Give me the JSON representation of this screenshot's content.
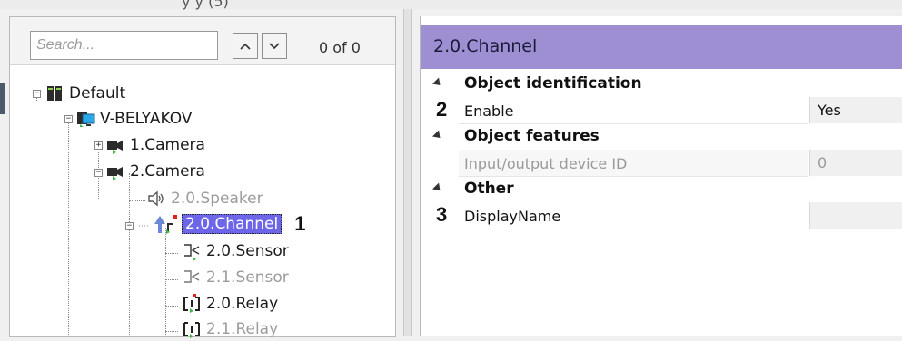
{
  "top_partial_text": "y           y            (5)",
  "search": {
    "placeholder": "Search...",
    "match_count": "0 of 0"
  },
  "tree": {
    "nodes": [
      {
        "label": "Default",
        "icon": "server-icon"
      },
      {
        "label": "V-BELYAKOV",
        "icon": "computer-icon"
      },
      {
        "label": "1.Camera",
        "icon": "camera-icon"
      },
      {
        "label": "2.Camera",
        "icon": "camera-icon"
      },
      {
        "label": "2.0.Speaker",
        "icon": "speaker-icon",
        "disabled": true
      },
      {
        "label": "2.0.Channel",
        "icon": "channel-arrow-icon",
        "selected": true
      },
      {
        "label": "2.0.Sensor",
        "icon": "sensor-icon"
      },
      {
        "label": "2.1.Sensor",
        "icon": "sensor-icon",
        "disabled": true
      },
      {
        "label": "2.0.Relay",
        "icon": "relay-icon"
      },
      {
        "label": "2.1.Relay",
        "icon": "relay-icon",
        "disabled": true
      }
    ],
    "callout": "1"
  },
  "properties": {
    "title": "2.0.Channel",
    "categories": [
      {
        "label": "Object identification"
      },
      {
        "label": "Object features"
      },
      {
        "label": "Other"
      }
    ],
    "items": [
      {
        "name": "Enable",
        "value": "Yes",
        "callout": "2"
      },
      {
        "name": "Input/output device ID",
        "value": "0",
        "disabled": true
      },
      {
        "name": "DisplayName",
        "value": "",
        "callout": "3"
      }
    ]
  },
  "colors": {
    "header": "#9d8fd2",
    "selection": "#6e66e8"
  }
}
